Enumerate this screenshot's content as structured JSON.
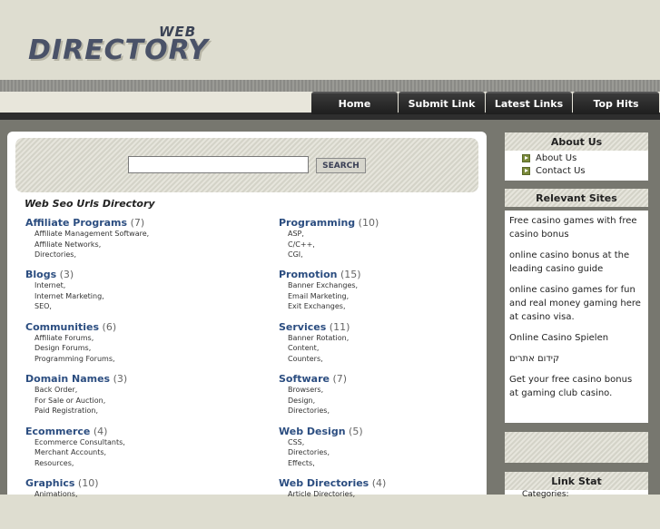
{
  "logo": {
    "small": "WEB",
    "large": "DIRECTORY"
  },
  "nav": [
    "Home",
    "Submit Link",
    "Latest Links",
    "Top Hits"
  ],
  "search": {
    "button": "SEARCH",
    "value": "",
    "placeholder": ""
  },
  "directory_title": "Web Seo Urls Directory",
  "categories_left": [
    {
      "name": "Affiliate Programs",
      "count": "(7)",
      "subs": [
        "Affiliate Management Software,",
        "Affiliate Networks,",
        "Directories,"
      ]
    },
    {
      "name": "Blogs",
      "count": "(3)",
      "subs": [
        "Internet,",
        "Internet Marketing,",
        "SEO,"
      ]
    },
    {
      "name": "Communities",
      "count": "(6)",
      "subs": [
        "Affiliate Forums,",
        "Design Forums,",
        "Programming Forums,"
      ]
    },
    {
      "name": "Domain Names",
      "count": "(3)",
      "subs": [
        "Back Order,",
        "For Sale or Auction,",
        "Paid Registration,"
      ]
    },
    {
      "name": "Ecommerce",
      "count": "(4)",
      "subs": [
        "Ecommerce Consultants,",
        "Merchant Accounts,",
        "Resources,"
      ]
    },
    {
      "name": "Graphics",
      "count": "(10)",
      "subs": [
        "Animations,"
      ]
    }
  ],
  "categories_right": [
    {
      "name": "Programming",
      "count": "(10)",
      "subs": [
        "ASP,",
        "C/C++,",
        "CGI,"
      ]
    },
    {
      "name": "Promotion",
      "count": "(15)",
      "subs": [
        "Banner Exchanges,",
        "Email Marketing,",
        "Exit Exchanges,"
      ]
    },
    {
      "name": "Services",
      "count": "(11)",
      "subs": [
        "Banner Rotation,",
        "Content,",
        "Counters,"
      ]
    },
    {
      "name": "Software",
      "count": "(7)",
      "subs": [
        "Browsers,",
        "Design,",
        "Directories,"
      ]
    },
    {
      "name": "Web Design",
      "count": "(5)",
      "subs": [
        "CSS,",
        "Directories,",
        "Effects,"
      ]
    },
    {
      "name": "Web Directories",
      "count": "(4)",
      "subs": [
        "Article Directories,"
      ]
    }
  ],
  "sidebar": {
    "about": {
      "title": "About Us",
      "items": [
        "About Us",
        "Contact Us"
      ]
    },
    "relevant": {
      "title": "Relevant Sites",
      "links": [
        "Free casino games with free casino bonus",
        "online casino bonus at the leading casino guide",
        "online casino games for fun and real money gaming here at casino visa.",
        "Online Casino Spielen",
        "קידום אתרים",
        "Get your free casino bonus at gaming club casino."
      ]
    },
    "link_stat": {
      "title": "Link Stat",
      "items": [
        "Categories:"
      ]
    }
  },
  "colors": {
    "accent_link": "#2b4d80",
    "nav_bg": "#1e1e1e",
    "page_bg": "#deddd0"
  }
}
